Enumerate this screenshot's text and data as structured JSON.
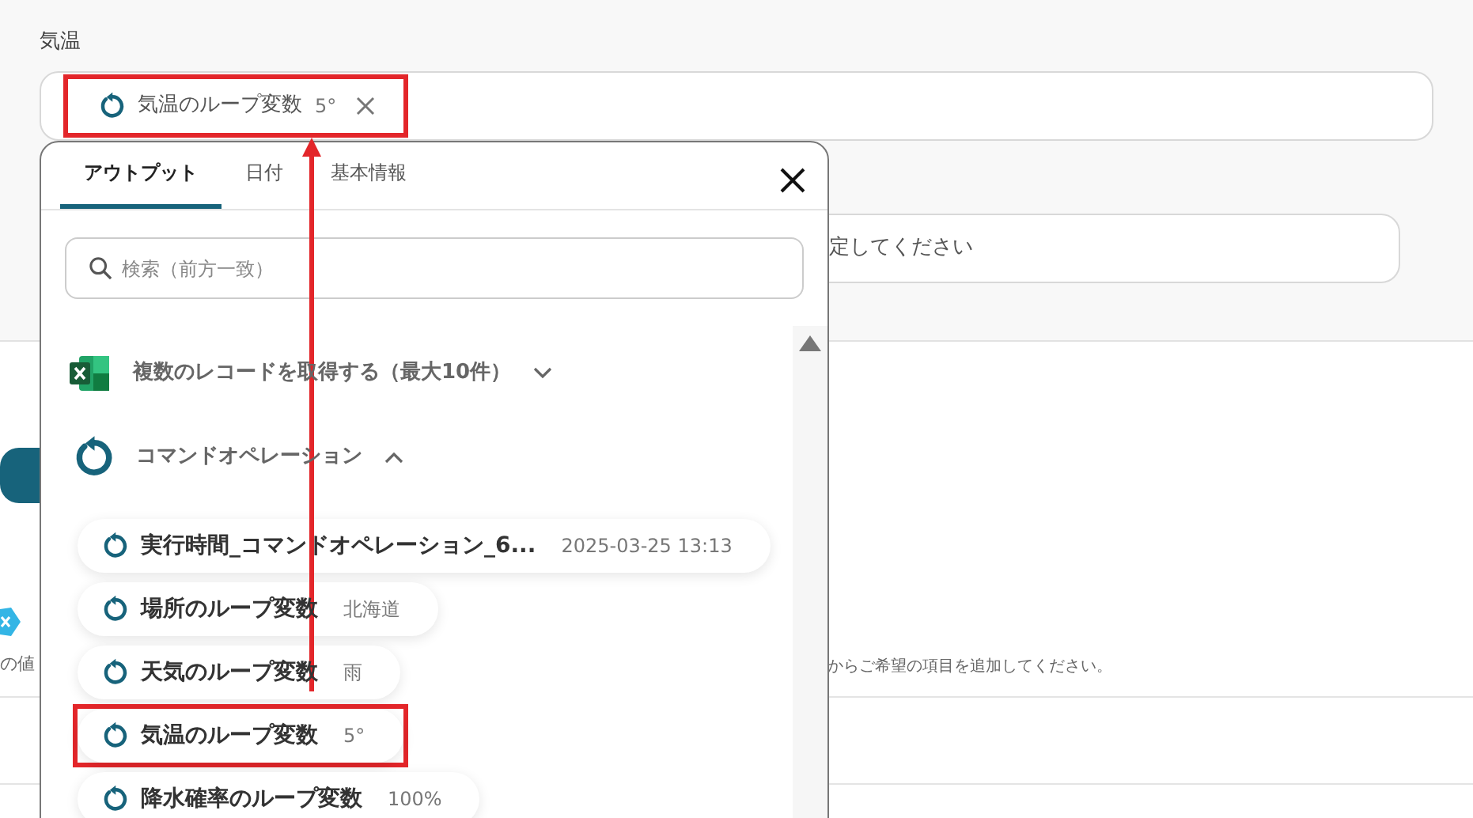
{
  "field_label": "気温",
  "temperature_field": {
    "chips": [
      {
        "label": "気温のループ変数",
        "value": "5°",
        "highlighted": true
      }
    ]
  },
  "second_field": {
    "text": "定してください"
  },
  "background": {
    "left_fragment": "の値",
    "hint": "からご希望の項目を追加してください。"
  },
  "popup": {
    "tabs": [
      {
        "label": "アウトプット",
        "selected": true
      },
      {
        "label": "日付",
        "selected": false
      },
      {
        "label": "基本情報",
        "selected": false
      }
    ],
    "search": {
      "placeholder": "検索（前方一致）"
    },
    "sections": [
      {
        "kind": "excel",
        "title": "複数のレコードを取得する（最大10件）",
        "expanded": false
      },
      {
        "kind": "command",
        "title": "コマンドオペレーション",
        "expanded": true,
        "items": [
          {
            "label": "実行時間_コマンドオペレーション_6...",
            "value": "2025-03-25 13:13",
            "highlighted": false
          },
          {
            "label": "場所のループ変数",
            "value": "北海道",
            "highlighted": false
          },
          {
            "label": "天気のループ変数",
            "value": "雨",
            "highlighted": false
          },
          {
            "label": "気温のループ変数",
            "value": "5°",
            "highlighted": true
          },
          {
            "label": "降水確率のループ変数",
            "value": "100%",
            "highlighted": false
          }
        ]
      }
    ]
  }
}
